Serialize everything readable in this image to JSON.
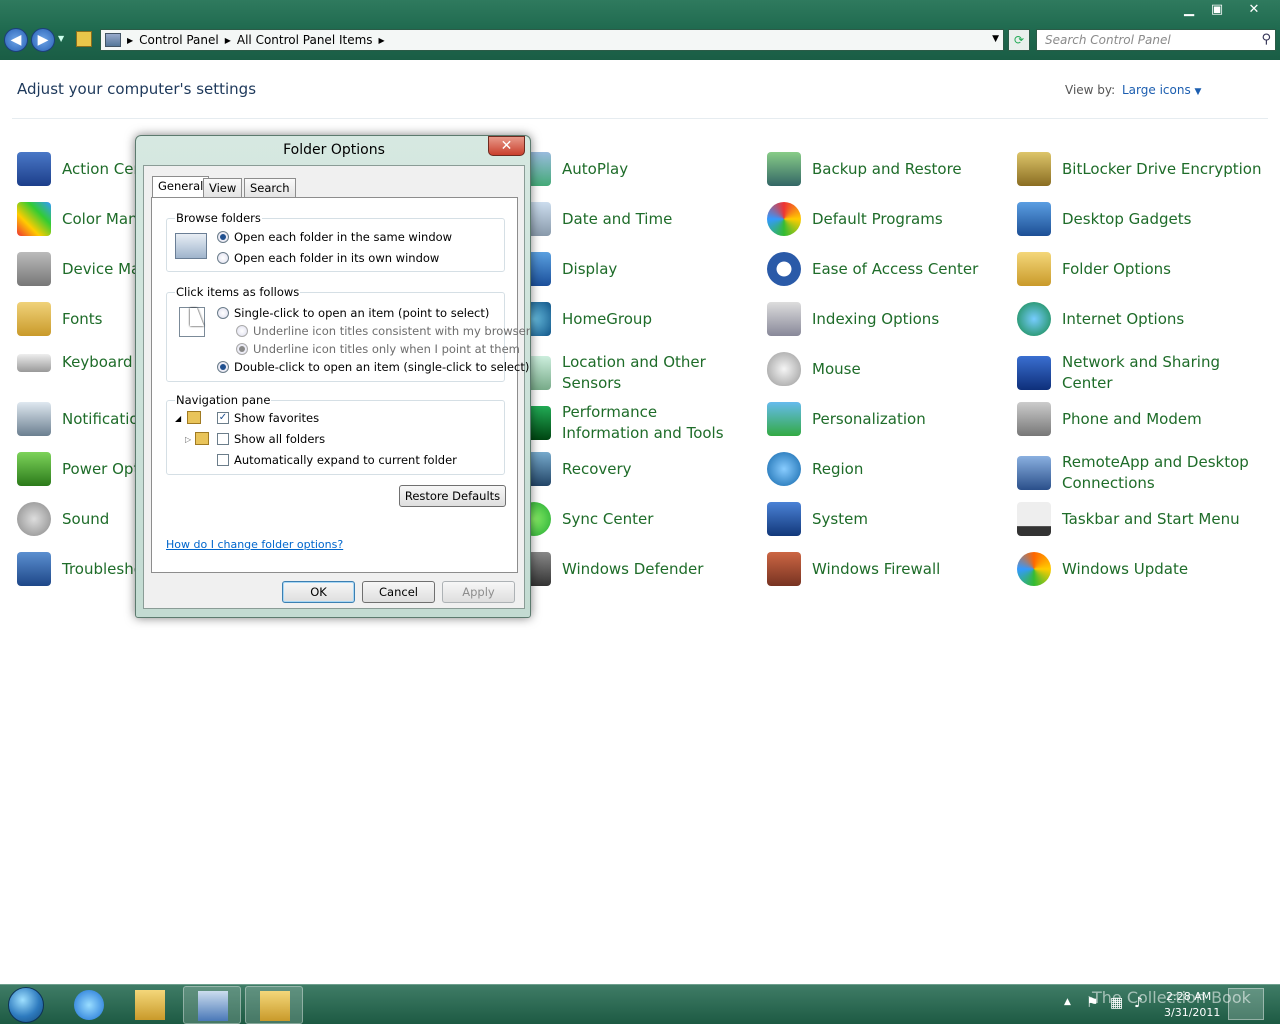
{
  "window": {
    "minimize_label": "▁",
    "maximize_label": "▣",
    "close_label": "✕"
  },
  "address": {
    "crumbs": [
      "Control Panel",
      "All Control Panel Items"
    ],
    "search_placeholder": "Search Control Panel"
  },
  "header": {
    "title": "Adjust your computer's settings",
    "viewby_label": "View by:",
    "viewby_value": "Large icons"
  },
  "items": {
    "c1": [
      "Action Center",
      "Color Management",
      "Device Manager",
      "Fonts",
      "Keyboard",
      "Notification Area Icons",
      "Power Options",
      "Sound",
      "Troubleshooting"
    ],
    "c3": [
      "AutoPlay",
      "Date and Time",
      "Display",
      "HomeGroup",
      "Location and Other Sensors",
      "Performance Information and Tools",
      "Recovery",
      "Sync Center",
      "Windows Defender"
    ],
    "c4": [
      "Backup and Restore",
      "Default Programs",
      "Ease of Access Center",
      "Indexing Options",
      "Mouse",
      "Personalization",
      "Region",
      "System",
      "Windows Firewall"
    ],
    "c5": [
      "BitLocker Drive Encryption",
      "Desktop Gadgets",
      "Folder Options",
      "Internet Options",
      "Network and Sharing Center",
      "Phone and Modem",
      "RemoteApp and Desktop Connections",
      "Taskbar and Start Menu",
      "Windows Update"
    ]
  },
  "dialog": {
    "title": "Folder Options",
    "tabs": [
      "General",
      "View",
      "Search"
    ],
    "browse": {
      "title": "Browse folders",
      "opt1": "Open each folder in the same window",
      "opt2": "Open each folder in its own window"
    },
    "click": {
      "title": "Click items as follows",
      "opt1": "Single-click to open an item (point to select)",
      "sub1": "Underline icon titles consistent with my browser",
      "sub2": "Underline icon titles only when I point at them",
      "opt2": "Double-click to open an item (single-click to select)"
    },
    "nav": {
      "title": "Navigation pane",
      "opt1": "Show favorites",
      "opt2": "Show all folders",
      "opt3": "Automatically expand to current folder"
    },
    "restore_label": "Restore Defaults",
    "help_link": "How do I change folder options?",
    "ok_label": "OK",
    "cancel_label": "Cancel",
    "apply_label": "Apply"
  },
  "taskbar": {
    "time": "2:28 AM",
    "date": "3/31/2011",
    "watermark": "The Collection Book"
  }
}
